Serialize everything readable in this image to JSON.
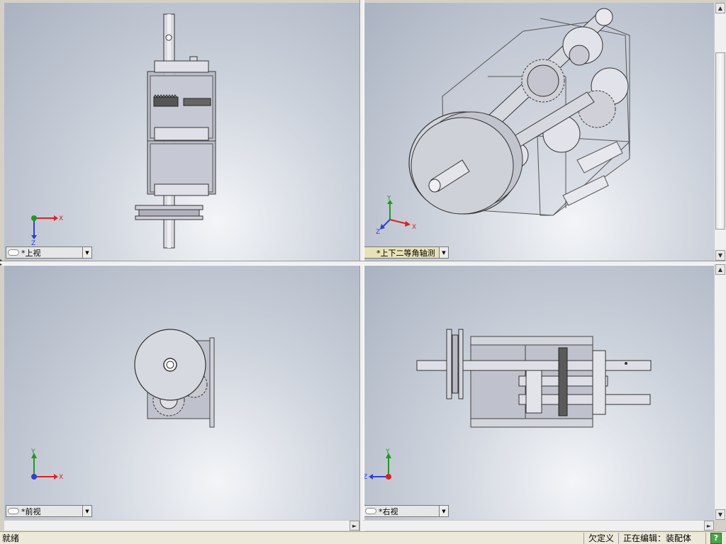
{
  "viewports": {
    "top": {
      "view_label": "*上视"
    },
    "iso": {
      "view_label": "*上下二等角轴测"
    },
    "front": {
      "view_label": "*前视"
    },
    "right": {
      "view_label": "*右视"
    }
  },
  "triad": {
    "x": "X",
    "y": "Y",
    "z": "Z"
  },
  "statusbar": {
    "ready": "就绪",
    "definition": "欠定义",
    "editing": "正在编辑：装配体",
    "help": "?"
  },
  "colors": {
    "viewport_top": "#a9b2c1",
    "viewport_bottom": "#f3f5f8",
    "part": "#d0d2dc",
    "axis_x": "#e0201e",
    "axis_y": "#1f9a1f",
    "axis_z": "#2d3fd8"
  }
}
